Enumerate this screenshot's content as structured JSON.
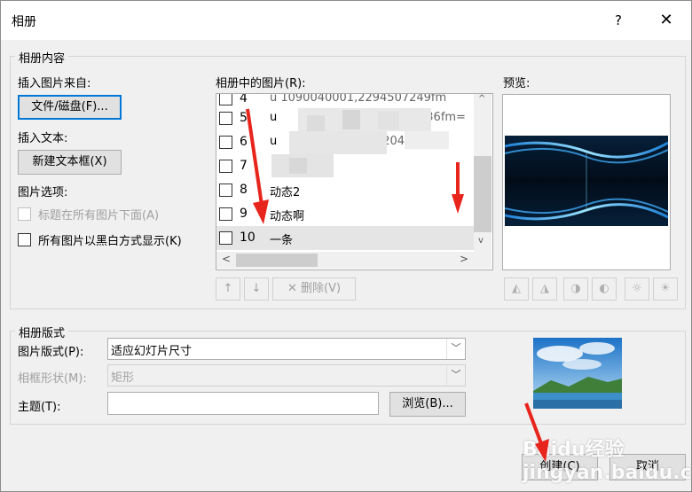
{
  "window": {
    "title": "相册",
    "help": "?",
    "close": "✕"
  },
  "content_group": {
    "label": "相册内容",
    "insert_from_label": "插入图片来自:",
    "file_button": "文件/磁盘(F)...",
    "insert_text_label": "插入文本:",
    "new_textbox_button": "新建文本框(X)",
    "picture_options_label": "图片选项:",
    "option_captions": "标题在所有图片下面(A)",
    "option_bw": "所有图片以黑白方式显示(K)"
  },
  "picture_list": {
    "label": "相册中的图片(R):",
    "rows": [
      {
        "num": "4",
        "name": ""
      },
      {
        "num": "5",
        "name": "u"
      },
      {
        "num": "6",
        "name": "u"
      },
      {
        "num": "7",
        "name": ""
      },
      {
        "num": "8",
        "name": "动态2"
      },
      {
        "num": "9",
        "name": "动态啊"
      },
      {
        "num": "10",
        "name": "一条"
      }
    ],
    "partial_text_row4": "u  1090040001,2294507249fm",
    "partial_text_row5": "336fm=",
    "partial_text_row6": "9900,204      fm=",
    "remove_button": "删除(V)",
    "up_icon": "↑",
    "down_icon": "↓",
    "scroll_left": "<",
    "scroll_right": ">",
    "scroll_up": "^",
    "scroll_down": "v"
  },
  "preview": {
    "label": "预览:"
  },
  "layout_group": {
    "label": "相册版式",
    "picture_layout_label": "图片版式(P):",
    "picture_layout_value": "适应幻灯片尺寸",
    "frame_shape_label": "相框形状(M):",
    "frame_shape_value": "矩形",
    "theme_label": "主题(T):",
    "theme_value": "",
    "browse_button": "浏览(B)..."
  },
  "footer": {
    "create_button": "创建(C)",
    "cancel_button": "取消"
  },
  "watermark": "Baidu经验  jingyan.baidu.com",
  "colors": {
    "accent": "#0078d7",
    "annotation_red": "#e8251d",
    "selection": "#e5e5e5"
  }
}
